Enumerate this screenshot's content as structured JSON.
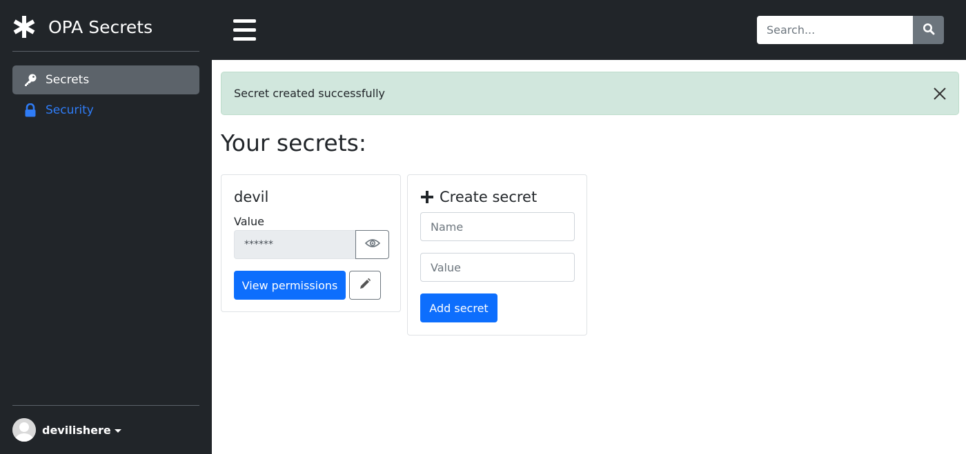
{
  "app": {
    "title": "OPA Secrets"
  },
  "sidebar": {
    "items": [
      {
        "label": "Secrets",
        "icon": "key-icon",
        "active": true
      },
      {
        "label": "Security",
        "icon": "lock-icon",
        "active": false
      }
    ],
    "user": {
      "name": "devilishere"
    }
  },
  "header": {
    "search": {
      "placeholder": "Search...",
      "value": ""
    }
  },
  "alert": {
    "message": "Secret created successfully"
  },
  "main": {
    "heading": "Your secrets:",
    "secrets": [
      {
        "name": "devil",
        "value_label": "Value",
        "masked_value": "******",
        "view_permissions_label": "View permissions"
      }
    ],
    "create_form": {
      "title": "Create secret",
      "name_placeholder": "Name",
      "value_placeholder": "Value",
      "submit_label": "Add secret"
    }
  },
  "colors": {
    "sidebar_bg": "#212529",
    "active_item_bg": "#5c636a",
    "link": "#2f7cf6",
    "primary": "#0d6efd",
    "alert_bg": "#d1e7dd",
    "search_button_bg": "#6c757d"
  }
}
